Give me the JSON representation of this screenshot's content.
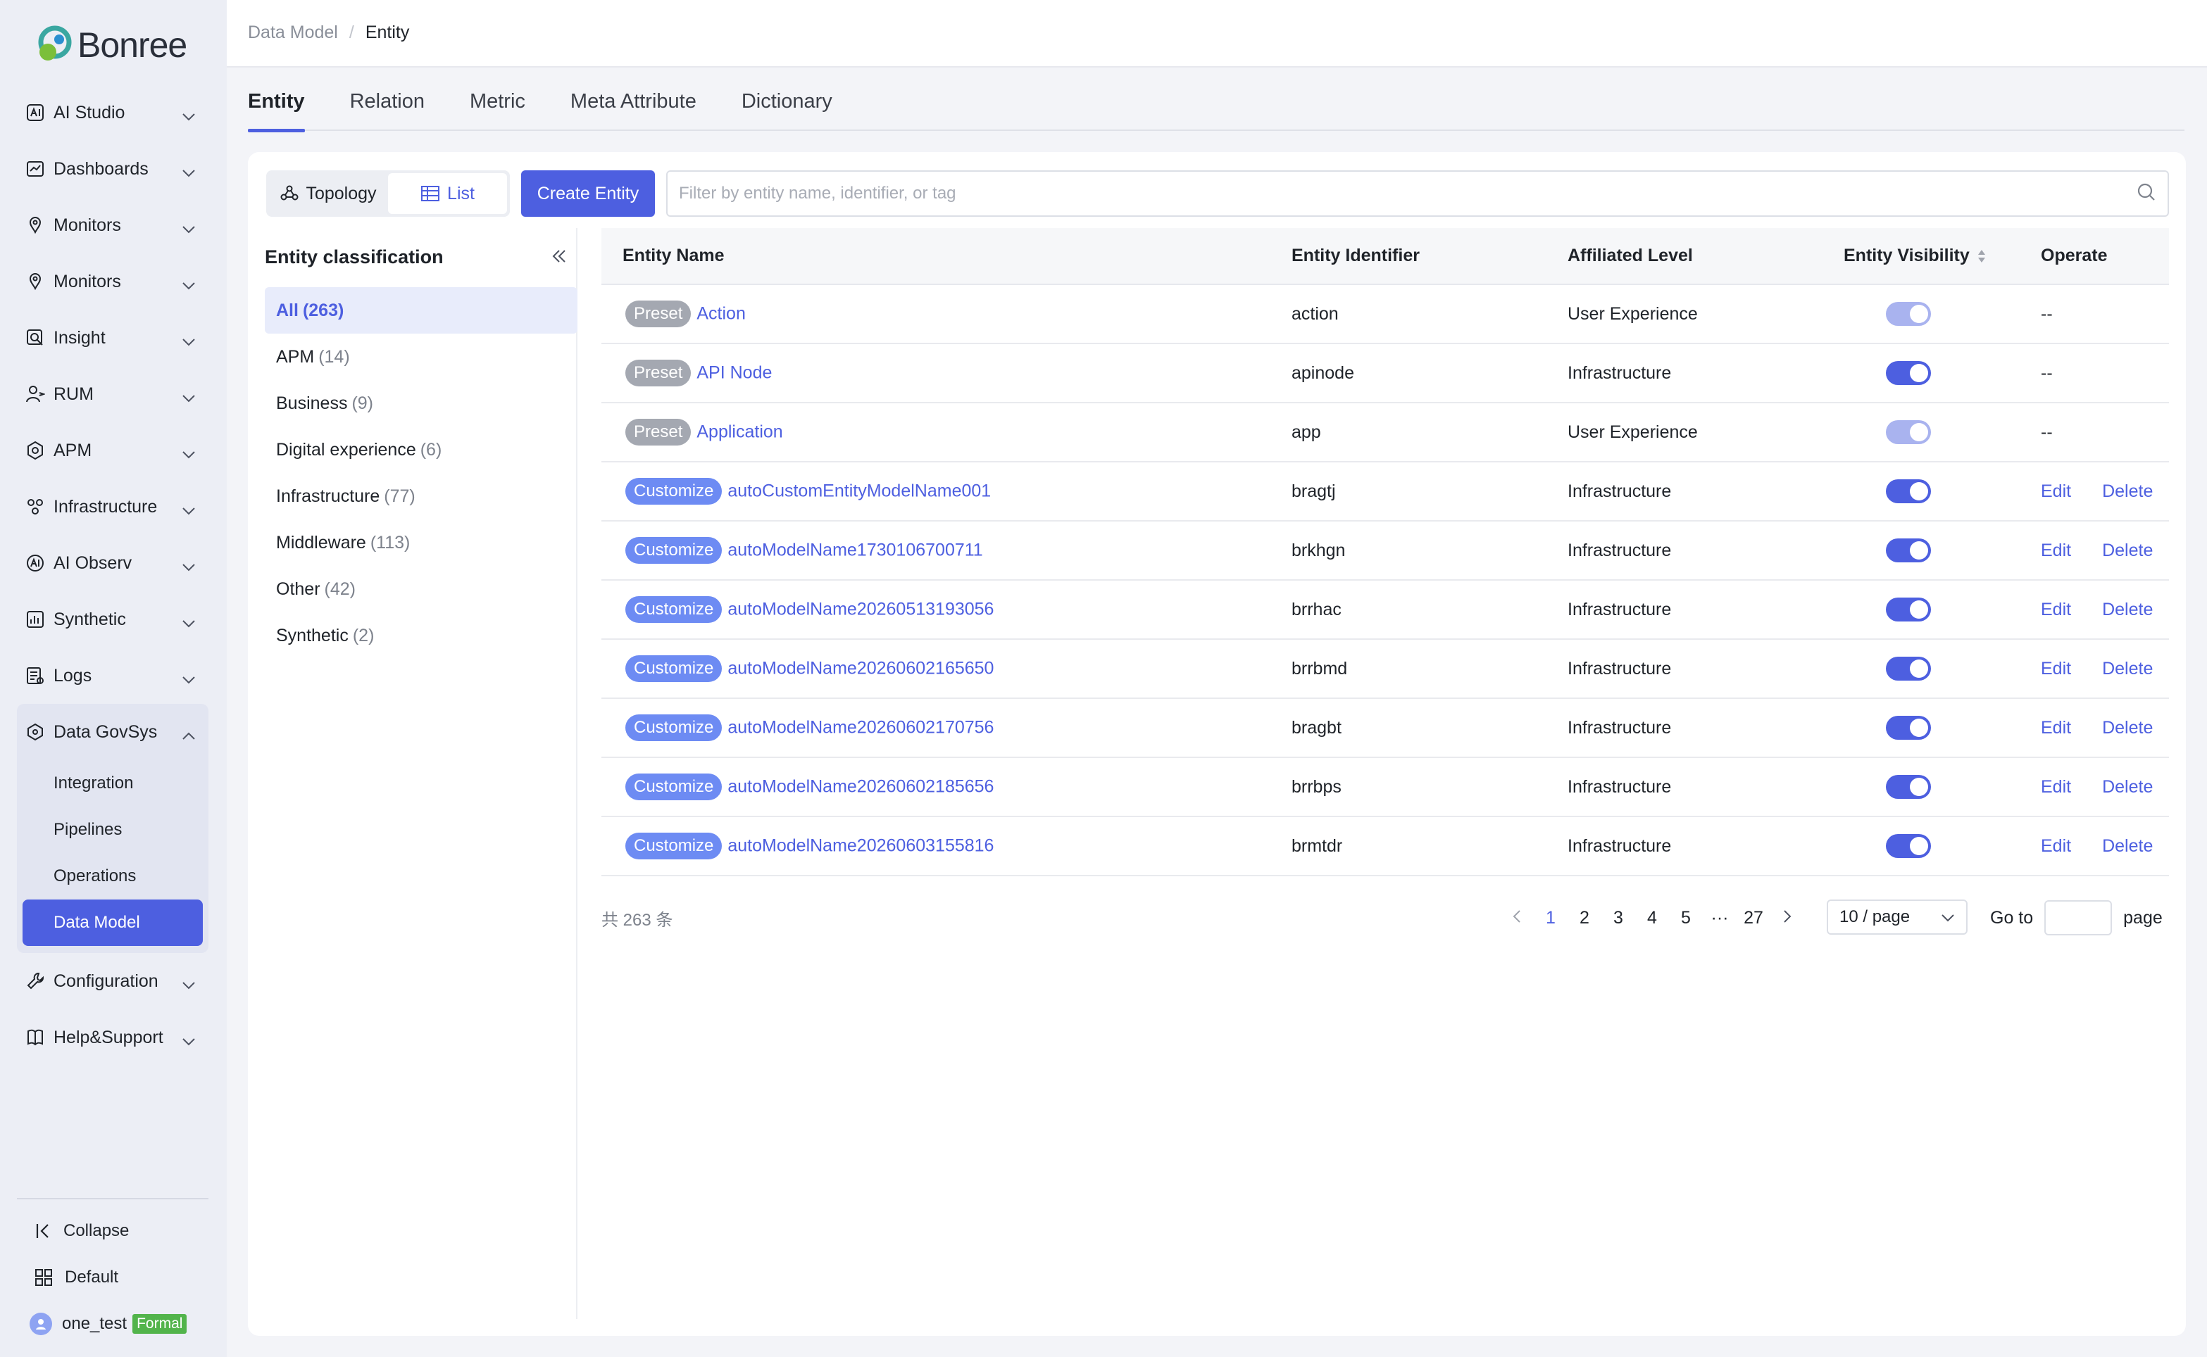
{
  "brand": {
    "name": "Bonree"
  },
  "sidebar": {
    "items": [
      {
        "label": "AI Studio",
        "icon": "ai-studio-icon"
      },
      {
        "label": "Dashboards",
        "icon": "dashboard-icon"
      },
      {
        "label": "Monitors",
        "icon": "monitor-icon"
      },
      {
        "label": "Monitors",
        "icon": "monitor-icon"
      },
      {
        "label": "Insight",
        "icon": "insight-icon"
      },
      {
        "label": "RUM",
        "icon": "rum-icon"
      },
      {
        "label": "APM",
        "icon": "apm-icon"
      },
      {
        "label": "Infrastructure",
        "icon": "infrastructure-icon"
      },
      {
        "label": "AI Observ",
        "icon": "ai-observ-icon"
      },
      {
        "label": "Synthetic",
        "icon": "synthetic-icon"
      },
      {
        "label": "Logs",
        "icon": "logs-icon"
      }
    ],
    "expanded": {
      "label": "Data GovSys",
      "children": [
        "Integration",
        "Pipelines",
        "Operations",
        "Data Model"
      ],
      "active_child": "Data Model"
    },
    "after": [
      {
        "label": "Configuration",
        "icon": "wrench-icon"
      },
      {
        "label": "Help&Support",
        "icon": "book-icon"
      }
    ],
    "bottom": {
      "collapse": "Collapse",
      "workspace": "Default",
      "user": "one_test",
      "user_badge": "Formal"
    }
  },
  "breadcrumb": {
    "parent": "Data Model",
    "separator": "/",
    "current": "Entity"
  },
  "tabs": [
    "Entity",
    "Relation",
    "Metric",
    "Meta Attribute",
    "Dictionary"
  ],
  "active_tab": "Entity",
  "toolbar": {
    "view_topology": "Topology",
    "view_list": "List",
    "create_label": "Create Entity",
    "search_placeholder": "Filter by entity name, identifier, or tag"
  },
  "classification": {
    "title": "Entity classification",
    "items": [
      {
        "label": "All",
        "count": "(263)",
        "active": true
      },
      {
        "label": "APM",
        "count": "(14)"
      },
      {
        "label": "Business",
        "count": "(9)"
      },
      {
        "label": "Digital experience",
        "count": "(6)"
      },
      {
        "label": "Infrastructure",
        "count": "(77)"
      },
      {
        "label": "Middleware",
        "count": "(113)"
      },
      {
        "label": "Other",
        "count": "(42)"
      },
      {
        "label": "Synthetic",
        "count": "(2)"
      }
    ]
  },
  "table": {
    "headers": [
      "Entity Name",
      "Entity Identifier",
      "Affiliated Level",
      "Entity Visibility",
      "Operate"
    ],
    "rows": [
      {
        "tag": "Preset",
        "name": "Action",
        "identifier": "action",
        "level": "User Experience",
        "visible": "disabled",
        "ops": [
          "--"
        ]
      },
      {
        "tag": "Preset",
        "name": "API Node",
        "identifier": "apinode",
        "level": "Infrastructure",
        "visible": "on",
        "ops": [
          "--"
        ]
      },
      {
        "tag": "Preset",
        "name": "Application",
        "identifier": "app",
        "level": "User Experience",
        "visible": "disabled",
        "ops": [
          "--"
        ]
      },
      {
        "tag": "Customize",
        "name": "autoCustomEntityModelName001",
        "identifier": "bragtj",
        "level": "Infrastructure",
        "visible": "on",
        "ops": [
          "Edit",
          "Delete"
        ]
      },
      {
        "tag": "Customize",
        "name": "autoModelName1730106700711",
        "identifier": "brkhgn",
        "level": "Infrastructure",
        "visible": "on",
        "ops": [
          "Edit",
          "Delete"
        ]
      },
      {
        "tag": "Customize",
        "name": "autoModelName20260513193056",
        "identifier": "brrhac",
        "level": "Infrastructure",
        "visible": "on",
        "ops": [
          "Edit",
          "Delete"
        ]
      },
      {
        "tag": "Customize",
        "name": "autoModelName20260602165650",
        "identifier": "brrbmd",
        "level": "Infrastructure",
        "visible": "on",
        "ops": [
          "Edit",
          "Delete"
        ]
      },
      {
        "tag": "Customize",
        "name": "autoModelName20260602170756",
        "identifier": "bragbt",
        "level": "Infrastructure",
        "visible": "on",
        "ops": [
          "Edit",
          "Delete"
        ]
      },
      {
        "tag": "Customize",
        "name": "autoModelName20260602185656",
        "identifier": "brrbps",
        "level": "Infrastructure",
        "visible": "on",
        "ops": [
          "Edit",
          "Delete"
        ]
      },
      {
        "tag": "Customize",
        "name": "autoModelName20260603155816",
        "identifier": "brmtdr",
        "level": "Infrastructure",
        "visible": "on",
        "ops": [
          "Edit",
          "Delete"
        ]
      }
    ]
  },
  "pagination": {
    "total": "共 263 条",
    "pages": [
      "1",
      "2",
      "3",
      "4",
      "5",
      "···",
      "27"
    ],
    "current": "1",
    "page_size": "10 / page",
    "goto_label": "Go to",
    "goto_value": "",
    "page_suffix": "page"
  },
  "colors": {
    "accent": "#4d5fe0",
    "preset_tag": "#a4a8b1",
    "custom_tag": "#6d8bf3",
    "formal_badge": "#52b44b"
  }
}
